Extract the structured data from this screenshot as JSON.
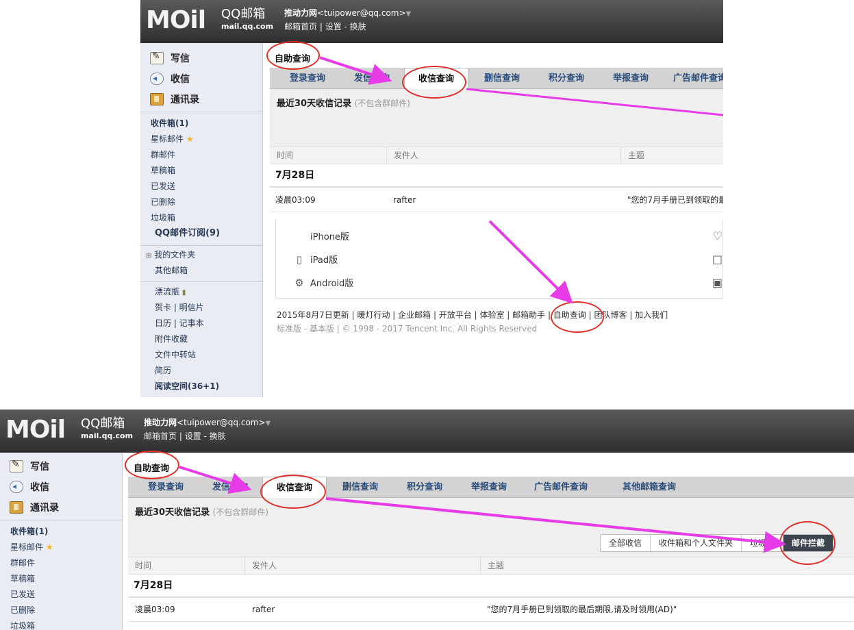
{
  "header": {
    "logo": "MOil",
    "brand": "QQ邮箱",
    "domain": "mail.qq.com",
    "account_name": "推动力网",
    "account_email": "<tuipower@qq.com>",
    "caret": "▼",
    "links": [
      "邮箱首页",
      "设置",
      "换肤"
    ]
  },
  "sidebar": {
    "compose": "写信",
    "inbox_action": "收信",
    "contacts": "通讯录",
    "folders": [
      "收件箱(1)",
      "星标邮件",
      "群邮件",
      "草稿箱",
      "已发送",
      "已删除",
      "垃圾箱",
      "QQ邮件订阅(9)"
    ],
    "star": "★",
    "my_folders": "我的文件夹",
    "other_mail": "其他邮箱",
    "extras": [
      "漂流瓶",
      "贺卡 | 明信片",
      "日历 | 记事本",
      "附件收藏",
      "文件中转站",
      "简历",
      "阅读空间(36+1)"
    ]
  },
  "main": {
    "page_title": "自助查询",
    "tabs": [
      "登录查询",
      "发信查询",
      "收信查询",
      "删信查询",
      "积分查询",
      "举报查询",
      "广告邮件查询",
      "其他邮箱查询"
    ],
    "section_title": "最近30天收信记录",
    "section_note": "(不包含群邮件)",
    "filters": [
      "全部收信",
      "收件箱和个人文件夹",
      "垃圾箱",
      "邮件拦截"
    ],
    "columns": [
      "时间",
      "发件人",
      "主题"
    ],
    "date_group": "7月28日",
    "row": {
      "time": "凌晨03:09",
      "sender": "rafter",
      "subject": "\"您的7月手册已到领取的最后期限,请及时领用(AD)\"",
      "subject_cut": "\"您的7月手册已到领取的最"
    }
  },
  "apps": [
    "iPhone版",
    "iPad版",
    "Android版"
  ],
  "footer": {
    "links_line": "2015年8月7日更新 | 暖灯行动 | 企业邮箱 | 开放平台 | 体验室 | 邮箱助手 | 自助查询 | 团队博客 | 加入我们",
    "copyright_line": "标准版 - 基本版 | © 1998 - 2017 Tencent Inc. All Rights Reserved"
  },
  "annotation": {
    "circle_color": "#e0302a",
    "arrow_color": "#e83be8"
  }
}
